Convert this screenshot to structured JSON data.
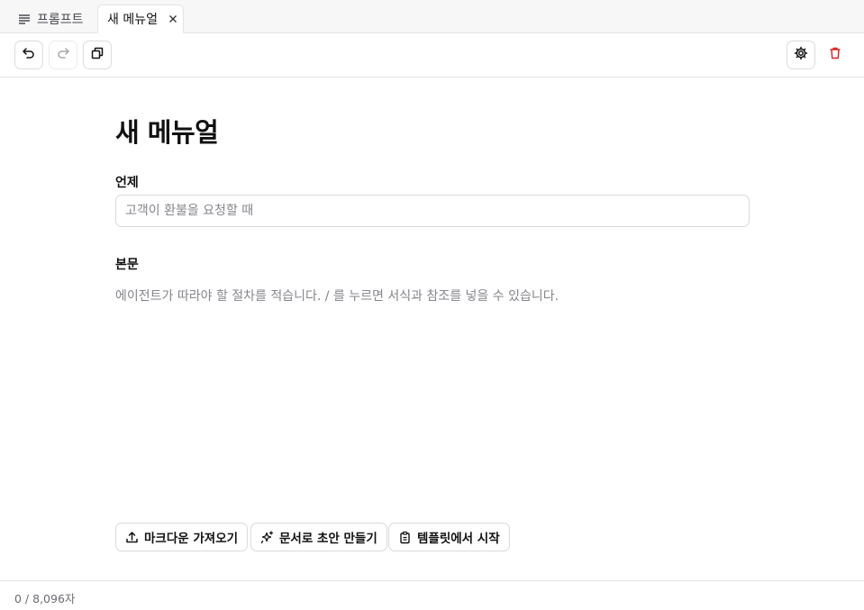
{
  "tabs": [
    {
      "label": "프롬프트",
      "icon": "text-lines-icon"
    },
    {
      "label": "새 메뉴얼",
      "icon": "close-icon"
    }
  ],
  "toolbar": {
    "left": [
      "undo-icon",
      "redo-icon",
      "duplicate-icon"
    ],
    "right": [
      "gear-icon",
      "trash-icon"
    ]
  },
  "editor": {
    "title": "새 메뉴얼",
    "trigger_label": "언제",
    "trigger_placeholder": "고객이 환불을 요청할 때",
    "trigger_value": "",
    "body_label": "본문",
    "body_placeholder": "에이전트가 따라야 할 절차를 적습니다. / 를 누르면 서식과 참조를 넣을 수 있습니다."
  },
  "actions": [
    {
      "label": "마크다운 가져오기",
      "icon": "upload-icon"
    },
    {
      "label": "문서로 초안 만들기",
      "icon": "sparkle-icon"
    },
    {
      "label": "템플릿에서 시작",
      "icon": "clipboard-icon"
    }
  ],
  "footer": {
    "char_count": "0 / 8,096자"
  },
  "colors": {
    "danger": "#dc2626",
    "border": "#d9d9de",
    "muted_text": "#85858c"
  }
}
